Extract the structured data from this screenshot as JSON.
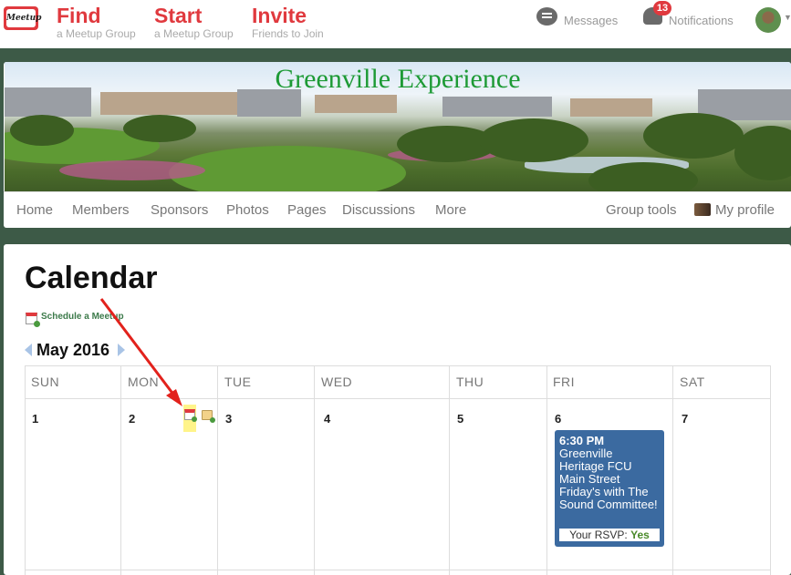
{
  "topnav": {
    "logo_text": "Meetup",
    "find": {
      "title": "Find",
      "subtitle": "a Meetup Group"
    },
    "start": {
      "title": "Start",
      "subtitle": "a Meetup Group"
    },
    "invite": {
      "title": "Invite",
      "subtitle": "Friends to Join"
    },
    "messages_label": "Messages",
    "notifications_label": "Notifications",
    "notifications_count": "13",
    "accent_color": "#e0393e"
  },
  "group": {
    "name": "Greenville Experience",
    "nav": [
      "Home",
      "Members",
      "Sponsors",
      "Photos",
      "Pages",
      "Discussions",
      "More"
    ],
    "group_tools": "Group tools",
    "my_profile": "My profile"
  },
  "calendar": {
    "title": "Calendar",
    "schedule_link": "Schedule a Meetup",
    "month": "May 2016",
    "weekdays": [
      "SUN",
      "MON",
      "TUE",
      "WED",
      "THU",
      "FRI",
      "SAT"
    ],
    "days": [
      "1",
      "2",
      "3",
      "4",
      "5",
      "6",
      "7"
    ],
    "event": {
      "time": "6:30 PM",
      "title": "Greenville Heritage FCU Main Street Friday's with The Sound Committee!",
      "rsvp_label": "Your RSVP:",
      "rsvp_value": "Yes",
      "color": "#3b6aa0"
    }
  }
}
